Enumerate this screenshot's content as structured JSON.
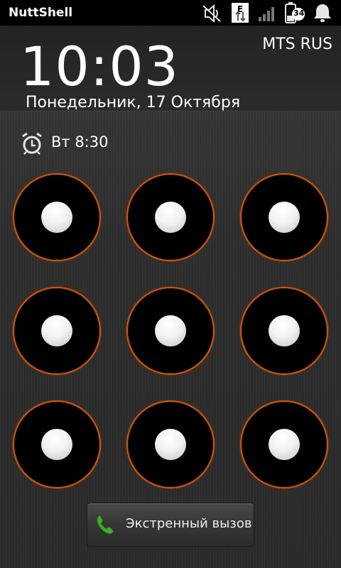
{
  "status_bar": {
    "app_name": "NuttShell",
    "network_type": "E",
    "battery_level": "34",
    "icons": [
      "sound-muted-icon",
      "data-transfer-icon",
      "signal-icon",
      "battery-icon",
      "notification-bell-icon"
    ]
  },
  "lock_screen": {
    "time": "10:03",
    "operator": "MTS RUS",
    "date": "Понедельник, 17 Октября",
    "alarm": "Вт 8:30"
  },
  "pattern_grid": {
    "rows": 3,
    "cols": 3,
    "ring_color": "#c35a16"
  },
  "emergency_button": {
    "label": "Экстренный вызов",
    "icon": "phone-icon",
    "icon_color": "#3fae2a"
  }
}
